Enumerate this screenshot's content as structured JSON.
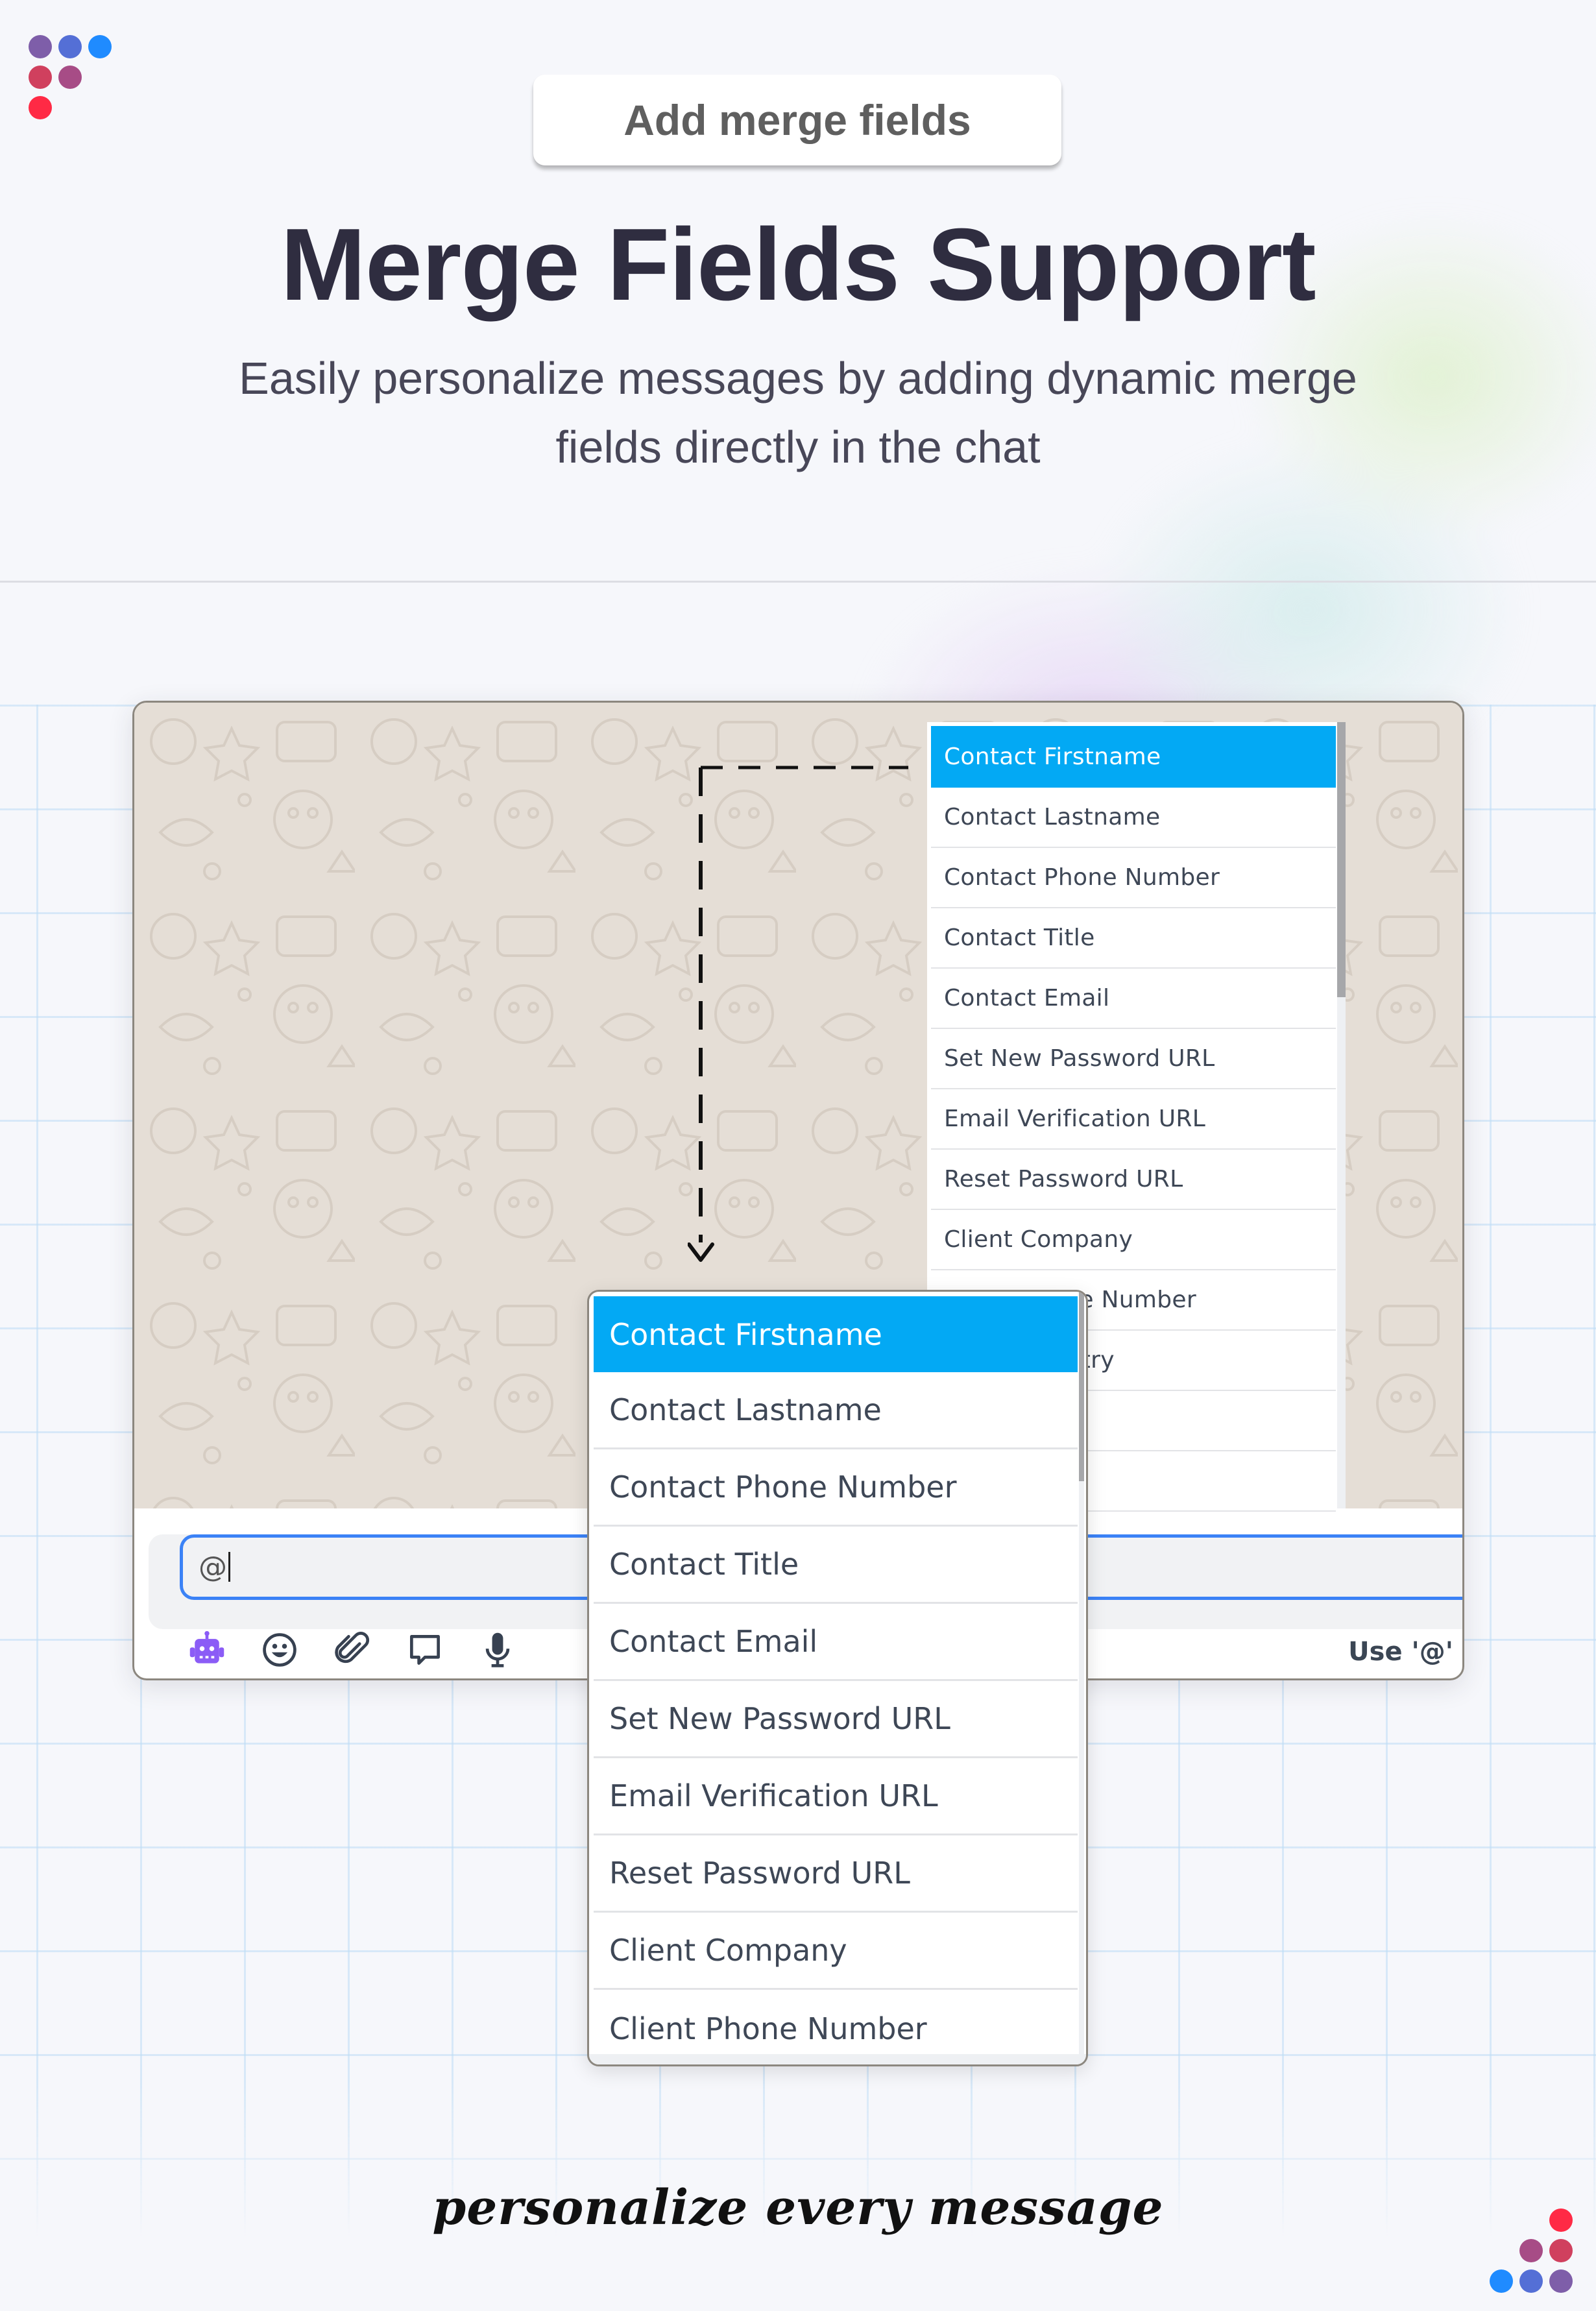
{
  "brand": {
    "logo_colors": [
      "#7e5ea9",
      "#546fd6",
      "#1f8bff",
      "#d0405e",
      "#a74c86",
      "#ff2a45"
    ]
  },
  "header": {
    "pill_label": "Add merge fields",
    "title": "Merge Fields Support",
    "subtitle_line1": "Easily personalize messages by adding dynamic merge",
    "subtitle_line2": "fields directly in the chat"
  },
  "chat": {
    "input_value": "@",
    "hint_text": "Use '@'",
    "toolbar": [
      {
        "icon": "robot-icon",
        "color": "#8b5cf6"
      },
      {
        "icon": "smile-icon",
        "color": "#374151"
      },
      {
        "icon": "paperclip-icon",
        "color": "#374151"
      },
      {
        "icon": "comment-icon",
        "color": "#374151"
      },
      {
        "icon": "microphone-icon",
        "color": "#374151"
      }
    ],
    "accent_color": "#3b82f6",
    "highlight_color": "#03a9f4"
  },
  "merge_fields_back": [
    "Contact Firstname",
    "Contact Lastname",
    "Contact Phone Number",
    "Contact Title",
    "Contact Email",
    "Set New Password URL",
    "Email Verification URL",
    "Reset Password URL",
    "Client Company",
    "Client Phone Number",
    "Client Country",
    "",
    ""
  ],
  "merge_fields_front": [
    "Contact Firstname",
    "Contact Lastname",
    "Contact Phone Number",
    "Contact Title",
    "Contact Email",
    "Set New Password URL",
    "Email Verification URL",
    "Reset Password URL",
    "Client Company",
    "Client Phone Number"
  ],
  "footer": {
    "tagline": "personalize every message"
  }
}
